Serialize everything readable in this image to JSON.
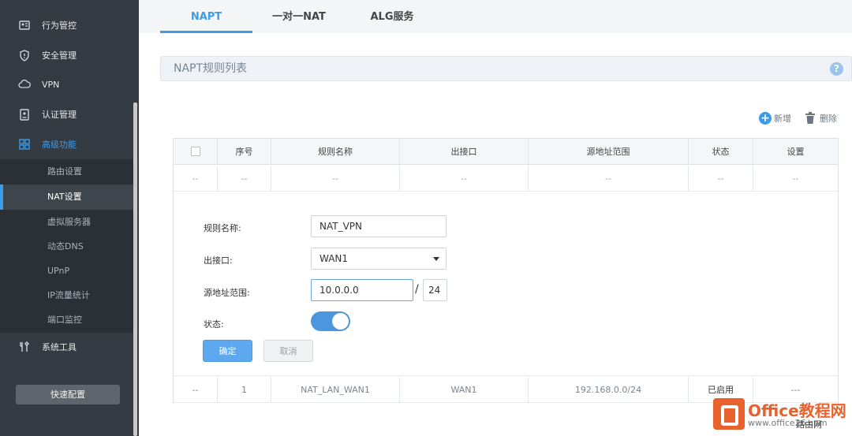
{
  "sidebar": {
    "items": [
      {
        "label": "行为管控",
        "icon": "behavior-icon"
      },
      {
        "label": "安全管理",
        "icon": "shield-icon"
      },
      {
        "label": "VPN",
        "icon": "cloud-vpn-icon"
      },
      {
        "label": "认证管理",
        "icon": "auth-icon"
      },
      {
        "label": "高级功能",
        "icon": "grid-icon"
      },
      {
        "label": "系统工具",
        "icon": "tools-icon"
      }
    ],
    "sub_items": [
      {
        "label": "路由设置"
      },
      {
        "label": "NAT设置"
      },
      {
        "label": "虚拟服务器"
      },
      {
        "label": "动态DNS"
      },
      {
        "label": "UPnP"
      },
      {
        "label": "IP流量统计"
      },
      {
        "label": "端口监控"
      }
    ],
    "quick_config": "快速配置"
  },
  "tabs": [
    {
      "label": "NAPT"
    },
    {
      "label": "一对一NAT"
    },
    {
      "label": "ALG服务"
    }
  ],
  "section": {
    "title": "NAPT规则列表",
    "help": "?"
  },
  "toolbar": {
    "add_label": "新增",
    "delete_label": "删除"
  },
  "table": {
    "headers": [
      "序号",
      "规则名称",
      "出接口",
      "源地址范围",
      "状态",
      "设置"
    ],
    "empty_row": [
      "--",
      "--",
      "--",
      "--",
      "--",
      "--",
      "--"
    ],
    "rows": [
      [
        "--",
        "1",
        "NAT_LAN_WAN1",
        "WAN1",
        "192.168.0.0/24",
        "已启用",
        "---"
      ]
    ]
  },
  "form": {
    "name_label": "规则名称:",
    "name_value": "NAT_VPN",
    "iface_label": "出接口:",
    "iface_value": "WAN1",
    "src_label": "源地址范围:",
    "src_ip": "10.0.0.0",
    "src_sep": "/",
    "src_mask": "24",
    "status_label": "状态:",
    "status_on": true,
    "ok_label": "确定",
    "cancel_label": "取消"
  },
  "watermark": {
    "brand": "Office教程网",
    "url": "www.office26.com",
    "corner": "路由网"
  },
  "colors": {
    "accent": "#3d9be9",
    "sidebar_bg": "#353b43",
    "watermark": "#e8622d"
  }
}
